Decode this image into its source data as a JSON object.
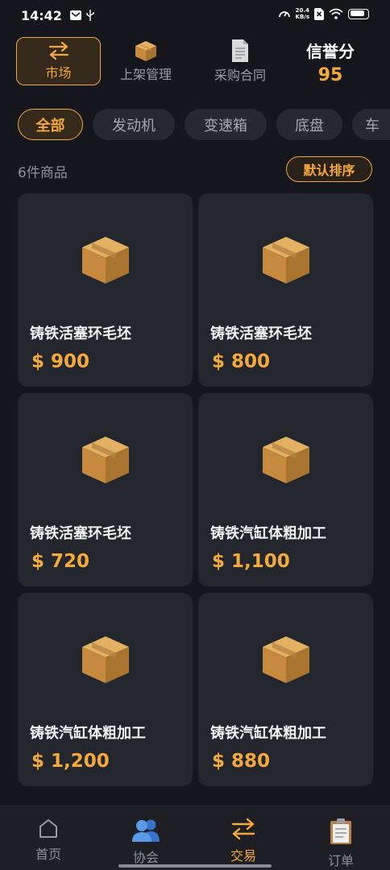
{
  "status_bar": {
    "time": "14:42",
    "net_speed_value": "20.4",
    "net_speed_unit": "KB/s",
    "icons": [
      "mail-icon",
      "usb-icon",
      "speedometer-icon",
      "sim-x-icon",
      "wifi-icon",
      "battery-icon"
    ]
  },
  "top_tabs": [
    {
      "label": "市场",
      "icon": "swap-arrows-icon",
      "active": true
    },
    {
      "label": "上架管理",
      "icon": "box-icon",
      "active": false
    },
    {
      "label": "采购合同",
      "icon": "document-icon",
      "active": false
    }
  ],
  "credit": {
    "label": "信誉分",
    "score": "95"
  },
  "filters": [
    {
      "label": "全部",
      "active": true
    },
    {
      "label": "发动机",
      "active": false
    },
    {
      "label": "变速箱",
      "active": false
    },
    {
      "label": "底盘",
      "active": false
    },
    {
      "label": "车",
      "active": false
    }
  ],
  "list": {
    "count_text": "6件商品",
    "sort_label": "默认排序"
  },
  "products": [
    {
      "name": "铸铁活塞环毛坯",
      "price": "$ 900"
    },
    {
      "name": "铸铁活塞环毛坯",
      "price": "$ 800"
    },
    {
      "name": "铸铁活塞环毛坯",
      "price": "$ 720"
    },
    {
      "name": "铸铁汽缸体粗加工",
      "price": "$ 1,100"
    },
    {
      "name": "铸铁汽缸体粗加工",
      "price": "$ 1,200"
    },
    {
      "name": "铸铁汽缸体粗加工",
      "price": "$ 880"
    }
  ],
  "bottom_nav": [
    {
      "label": "首页",
      "icon": "home-icon",
      "active": false
    },
    {
      "label": "协会",
      "icon": "people-icon",
      "active": false
    },
    {
      "label": "交易",
      "icon": "swap-arrows-icon",
      "active": true
    },
    {
      "label": "订单",
      "icon": "clipboard-icon",
      "active": false
    }
  ],
  "colors": {
    "accent": "#f5a93b",
    "background": "#15171d",
    "card": "#24262d"
  }
}
